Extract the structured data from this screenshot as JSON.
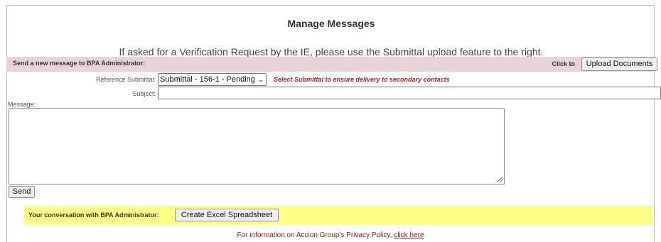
{
  "page": {
    "title": "Manage Messages",
    "subtitle": "If asked for a Verification Request by the IE, please use the Submittal upload feature to the right."
  },
  "send_bar": {
    "label": "Send a new message to BPA Administrator:",
    "click_to": "Click to",
    "upload_button": "Upload Documents"
  },
  "form": {
    "reference_label": "Reference Submittal:",
    "reference_value": "Submittal - 156-1 - Pending",
    "reference_hint": "Select Submittal to ensure delivery to secondary contacts",
    "subject_label": "Subject:",
    "subject_value": "",
    "message_label": "Message:",
    "message_value": "",
    "send_button": "Send"
  },
  "conversation": {
    "label": "Your conversation with BPA Administrator:",
    "excel_button": "Create Excel Spreadsheet"
  },
  "footer": {
    "privacy_text": "For information on Accion Group's Privacy Policy, ",
    "privacy_link": "click here"
  },
  "colors": {
    "send_bar_bg": "#e8d3d6",
    "conversation_bar_bg": "#ffff88",
    "hint_color": "#b22222"
  }
}
